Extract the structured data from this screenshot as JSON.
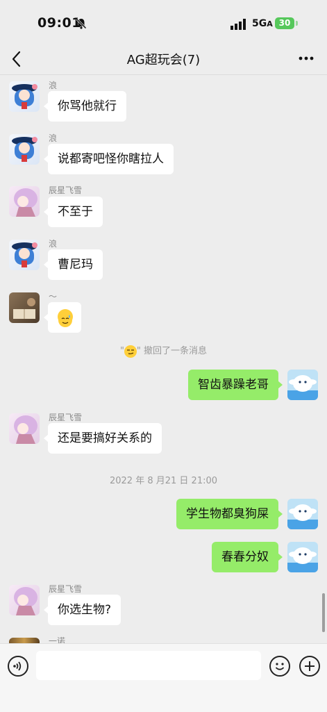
{
  "status_bar": {
    "time": "09:01",
    "network": "5G",
    "battery": "30"
  },
  "header": {
    "title": "AG超玩会(7)"
  },
  "messages": [
    {
      "sender": "浪",
      "text": "你骂他就行"
    },
    {
      "sender": "浪",
      "text": "说都寄吧怪你瞎拉人"
    },
    {
      "sender": "辰星飞雪",
      "text": "不至于"
    },
    {
      "sender": "浪",
      "text": "曹尼玛"
    },
    {
      "sender": "～",
      "text": ""
    },
    {
      "sender": "",
      "text": "智齿暴躁老哥"
    },
    {
      "sender": "辰星飞雪",
      "text": "还是要搞好关系的"
    },
    {
      "sender": "",
      "text": "学生物都臭狗屎"
    },
    {
      "sender": "",
      "text": "春春分奴"
    },
    {
      "sender": "辰星飞雪",
      "text": "你选生物?"
    },
    {
      "sender": "一诺",
      "text": ""
    }
  ],
  "system": {
    "recall_prefix": "\"",
    "recall_suffix": "\" 撤回了一条消息",
    "timestamp": "2022 年 8 月21 日 21:00"
  },
  "input": {
    "placeholder": ""
  }
}
